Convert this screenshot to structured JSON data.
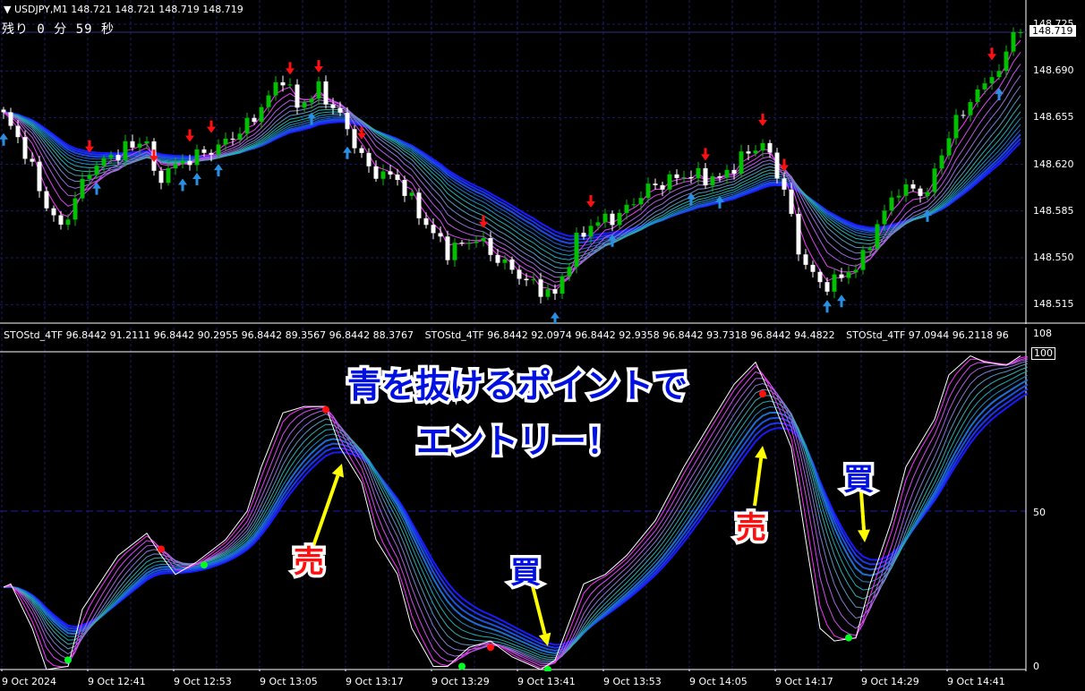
{
  "header": {
    "symbol_line": "▼ USDJPY,M1  148.721 148.721 148.719 148.719",
    "remaining": "残り 0 分 59 秒",
    "current_price": "148.719"
  },
  "indicator": {
    "labels": [
      "STOStd_4TF 96.8442 91.2111 96.8442 90.2955 96.8442 89.3567 96.8442 88.3767",
      "STOStd_4TF 96.8442 92.0974 96.8442 92.9358 96.8442 93.7318 96.8442 94.4822",
      "STOStd_4TF 97.0944 96.2118 96"
    ],
    "scale_top": "108",
    "scale_100": "100",
    "scale_50": "50",
    "scale_0": "0"
  },
  "annotations": {
    "main_line1": "青を抜けるポイントで",
    "main_line2": "エントリー！",
    "sell": "売",
    "buy": "買"
  },
  "colors": {
    "bull_candle": "#00c000",
    "bear_candle": "#ffffff",
    "sell_arrow": "#ff1010",
    "buy_arrow": "#2a8fe0",
    "ribbon_near": "#ff30ff",
    "ribbon_mid": "#20b8a8",
    "ribbon_far": "#1a1aff",
    "arrow_annotation": "#ffff00",
    "grid": "#1a1a6a"
  },
  "chart_data": [
    {
      "type": "candlestick",
      "symbol": "USDJPY",
      "timeframe": "M1",
      "y_ticks": [
        "148.725",
        "148.690",
        "148.655",
        "148.620",
        "148.585",
        "148.550",
        "148.515"
      ],
      "ylim": [
        148.505,
        148.728
      ],
      "x_ticks": [
        "9 Oct 2024",
        "9 Oct 12:41",
        "9 Oct 12:53",
        "9 Oct 13:05",
        "9 Oct 13:17",
        "9 Oct 13:29",
        "9 Oct 13:41",
        "9 Oct 13:53",
        "9 Oct 14:05",
        "9 Oct 14:17",
        "9 Oct 14:29",
        "9 Oct 14:41"
      ],
      "x_start": "12:29",
      "close_path": [
        [
          "12:29",
          148.656
        ],
        [
          "12:31",
          148.64
        ],
        [
          "12:32",
          148.629
        ],
        [
          "12:35",
          148.589
        ],
        [
          "12:37",
          148.572
        ],
        [
          "12:41",
          148.616
        ],
        [
          "12:45",
          148.629
        ],
        [
          "12:49",
          148.639
        ],
        [
          "12:50",
          148.609
        ],
        [
          "12:54",
          148.622
        ],
        [
          "12:59",
          148.633
        ],
        [
          "13:03",
          148.649
        ],
        [
          "13:05",
          148.663
        ],
        [
          "13:08",
          148.686
        ],
        [
          "13:10",
          148.663
        ],
        [
          "13:13",
          148.676
        ],
        [
          "13:16",
          148.656
        ],
        [
          "13:20",
          148.616
        ],
        [
          "13:24",
          148.609
        ],
        [
          "13:28",
          148.575
        ],
        [
          "13:31",
          148.555
        ],
        [
          "13:35",
          148.565
        ],
        [
          "13:38",
          148.549
        ],
        [
          "13:43",
          148.529
        ],
        [
          "13:46",
          148.522
        ],
        [
          "13:49",
          148.562
        ],
        [
          "13:51",
          148.575
        ],
        [
          "13:55",
          148.582
        ],
        [
          "13:59",
          148.602
        ],
        [
          "14:04",
          148.612
        ],
        [
          "14:09",
          148.609
        ],
        [
          "14:13",
          148.629
        ],
        [
          "14:15",
          148.636
        ],
        [
          "14:18",
          148.602
        ],
        [
          "14:20",
          148.555
        ],
        [
          "14:23",
          148.529
        ],
        [
          "14:26",
          148.535
        ],
        [
          "14:29",
          148.549
        ],
        [
          "14:31",
          148.575
        ],
        [
          "14:34",
          148.602
        ],
        [
          "14:38",
          148.599
        ],
        [
          "14:41",
          148.643
        ],
        [
          "14:45",
          148.676
        ],
        [
          "14:48",
          148.69
        ],
        [
          "14:50",
          148.719
        ]
      ],
      "sell_signals": [
        "12:41",
        "12:50",
        "12:55",
        "12:58",
        "13:09",
        "13:13",
        "13:19",
        "13:36",
        "13:51",
        "14:07",
        "14:15",
        "14:18",
        "14:47"
      ],
      "buy_signals": [
        "12:29",
        "12:42",
        "12:54",
        "12:56",
        "12:59",
        "13:12",
        "13:17",
        "13:46",
        "13:54",
        "14:05",
        "14:09",
        "14:24",
        "14:26",
        "14:38",
        "14:48"
      ]
    },
    {
      "type": "line",
      "name": "STOStd_4TF",
      "ylim": [
        0,
        108
      ],
      "y_ticks": [
        "100",
        "50",
        "0"
      ],
      "values": [
        [
          "12:29",
          26
        ],
        [
          "12:30",
          27
        ],
        [
          "12:33",
          13
        ],
        [
          "12:35",
          0
        ],
        [
          "12:38",
          1
        ],
        [
          "12:40",
          19
        ],
        [
          "12:45",
          36
        ],
        [
          "12:49",
          43
        ],
        [
          "12:51",
          36
        ],
        [
          "12:53",
          30
        ],
        [
          "12:56",
          34
        ],
        [
          "13:00",
          41
        ],
        [
          "13:03",
          50
        ],
        [
          "13:05",
          64
        ],
        [
          "13:08",
          81
        ],
        [
          "13:11",
          83
        ],
        [
          "13:14",
          83
        ],
        [
          "13:16",
          70
        ],
        [
          "13:19",
          59
        ],
        [
          "13:21",
          41
        ],
        [
          "13:24",
          30
        ],
        [
          "13:26",
          13
        ],
        [
          "13:29",
          1
        ],
        [
          "13:31",
          1
        ],
        [
          "13:34",
          7
        ],
        [
          "13:37",
          9
        ],
        [
          "13:40",
          4
        ],
        [
          "13:44",
          0
        ],
        [
          "13:46",
          3
        ],
        [
          "13:50",
          27
        ],
        [
          "13:53",
          30
        ],
        [
          "13:56",
          36
        ],
        [
          "14:00",
          47
        ],
        [
          "14:04",
          64
        ],
        [
          "14:08",
          79
        ],
        [
          "14:11",
          90
        ],
        [
          "14:14",
          97
        ],
        [
          "14:16",
          87
        ],
        [
          "14:19",
          70
        ],
        [
          "14:21",
          41
        ],
        [
          "14:23",
          13
        ],
        [
          "14:25",
          9
        ],
        [
          "14:28",
          10
        ],
        [
          "14:30",
          27
        ],
        [
          "14:33",
          47
        ],
        [
          "14:35",
          64
        ],
        [
          "14:39",
          79
        ],
        [
          "14:41",
          93
        ],
        [
          "14:44",
          99
        ],
        [
          "14:46",
          97
        ],
        [
          "14:49",
          96
        ],
        [
          "14:51",
          99
        ]
      ],
      "buy_dots": [
        [
          "12:38",
          3
        ],
        [
          "12:57",
          33
        ],
        [
          "13:33",
          1
        ],
        [
          "13:45",
          0
        ],
        [
          "14:27",
          10
        ]
      ],
      "sell_dots": [
        [
          "12:51",
          38
        ],
        [
          "13:14",
          82
        ],
        [
          "13:37",
          7
        ],
        [
          "14:15",
          87
        ]
      ]
    }
  ]
}
